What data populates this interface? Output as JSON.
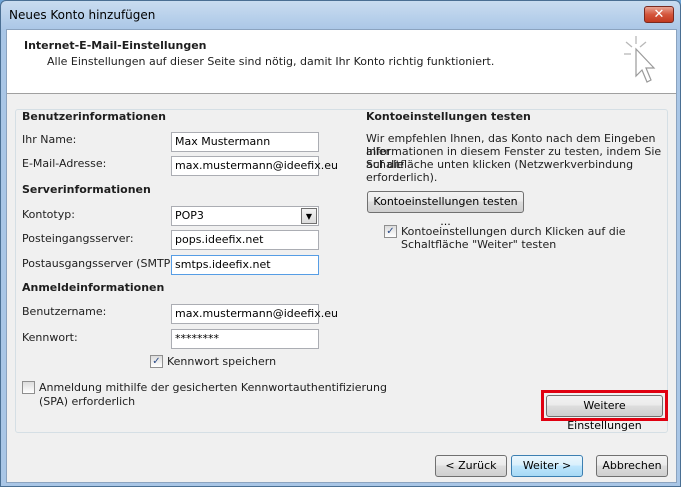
{
  "window": {
    "title": "Neues Konto hinzufügen",
    "close_glyph": "✕"
  },
  "header": {
    "title": "Internet-E-Mail-Einstellungen",
    "subtitle": "Alle Einstellungen auf dieser Seite sind nötig, damit Ihr Konto richtig funktioniert.",
    "icon": "cursor-sparkle-icon"
  },
  "user_info": {
    "heading": "Benutzerinformationen",
    "name_label": "Ihr Name:",
    "name_value": "Max Mustermann",
    "email_label": "E-Mail-Adresse:",
    "email_value": "max.mustermann@ideefix.eu"
  },
  "server_info": {
    "heading": "Serverinformationen",
    "type_label": "Kontotyp:",
    "type_value": "POP3",
    "incoming_label": "Posteingangsserver:",
    "incoming_value": "pops.ideefix.net",
    "outgoing_label": "Postausgangsserver (SMTP):",
    "outgoing_value": "smtps.ideefix.net"
  },
  "login_info": {
    "heading": "Anmeldeinformationen",
    "username_label": "Benutzername:",
    "username_value": "max.mustermann@ideefix.eu",
    "password_label": "Kennwort:",
    "password_value": "********",
    "remember_label": "Kennwort speichern",
    "remember_checked": true,
    "spa_label_line1": "Anmeldung mithilfe der gesicherten Kennwortauthentifizierung",
    "spa_label_line2": "(SPA) erforderlich",
    "spa_checked": false
  },
  "test_settings": {
    "heading": "Kontoeinstellungen testen",
    "desc_line1": "Wir empfehlen Ihnen, das Konto nach dem Eingeben aller",
    "desc_line2": "Informationen in diesem Fenster zu testen, indem Sie auf die",
    "desc_line3": "Schaltfläche unten klicken (Netzwerkverbindung erforderlich).",
    "test_button": "Kontoeinstellungen testen ...",
    "auto_test_line1": "Kontoeinstellungen durch Klicken auf die",
    "auto_test_line2": "Schaltfläche \"Weiter\" testen",
    "auto_test_checked": true,
    "more_settings_button": "Weitere Einstellungen"
  },
  "footer": {
    "back": "< Zurück",
    "next": "Weiter >",
    "cancel": "Abbrechen"
  },
  "colors": {
    "highlight": "#e00010",
    "accent": "#3c7fb1"
  }
}
